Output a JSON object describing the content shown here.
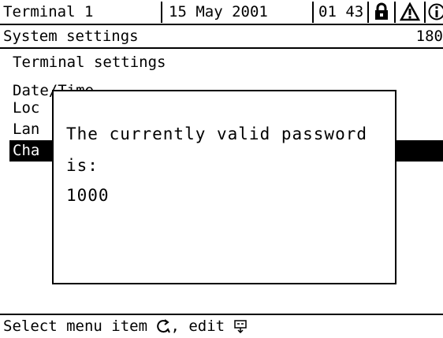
{
  "status_bar": {
    "terminal": "Terminal 1",
    "date": "15 May  2001",
    "time": "01 43",
    "icons": [
      "lock-icon",
      "warning-icon",
      "info-icon"
    ]
  },
  "header": {
    "title": "System settings",
    "value": "180"
  },
  "menu": {
    "items": [
      {
        "label": "Terminal settings"
      },
      {
        "label": "Date/Time"
      },
      {
        "label": "Loc"
      },
      {
        "label": "Lan"
      },
      {
        "label": "Cha",
        "selected": true
      }
    ]
  },
  "dialog": {
    "line1": "The currently valid password",
    "line2": "is:",
    "line3": "1000"
  },
  "footer": {
    "text_part1": "Select menu item",
    "text_part2": ", edit",
    "icons": [
      "rotary-knob-icon",
      "ok-button-icon"
    ]
  }
}
